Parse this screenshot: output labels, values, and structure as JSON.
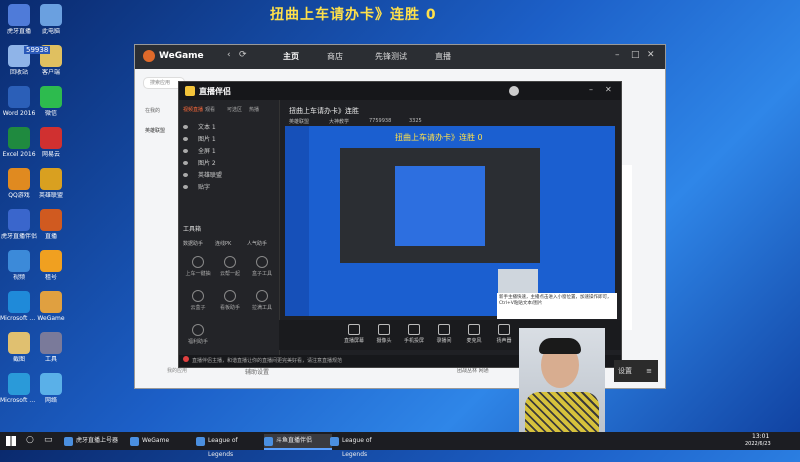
{
  "stream": {
    "title": "扭曲上车请办卡》连胜 0"
  },
  "desktop": {
    "icons": [
      {
        "label": "虎牙直播",
        "color": "#4f7bd9"
      },
      {
        "label": "此电脑",
        "color": "#6aa0e0"
      },
      {
        "label": "回收站",
        "color": "#8fb4e8"
      },
      {
        "label": "客户端",
        "color": "#e0c060"
      },
      {
        "label": "Word 2016",
        "color": "#2b5fb8"
      },
      {
        "label": "微信",
        "color": "#2dbb4e"
      },
      {
        "label": "Excel 2016",
        "color": "#1f8a3f"
      },
      {
        "label": "网易云",
        "color": "#d03030"
      },
      {
        "label": "QQ游戏",
        "color": "#e08a20"
      },
      {
        "label": "英雄联盟",
        "color": "#d9a020"
      },
      {
        "label": "虎牙直播伴侣",
        "color": "#3a66cc"
      },
      {
        "label": "直播",
        "color": "#d05a20"
      },
      {
        "label": "视频",
        "color": "#3c8ad9"
      },
      {
        "label": "租号",
        "color": "#f0a020"
      },
      {
        "label": "Microsoft Edge",
        "color": "#1f8ad9"
      },
      {
        "label": "WeGame",
        "color": "#e0a040"
      },
      {
        "label": "截图",
        "color": "#e0c070"
      },
      {
        "label": "工具",
        "color": "#7a7a9a"
      },
      {
        "label": "Microsoft Edge",
        "color": "#2a9ad9"
      },
      {
        "label": "网络",
        "color": "#5ab0e8"
      }
    ],
    "badge": "59938"
  },
  "wegame": {
    "brand": "WeGame",
    "tabs": [
      "主页",
      "商店",
      "先锋测试",
      "直播"
    ],
    "search_placeholder": "搜索应用",
    "side_items": [
      "在我的",
      "英雄联盟"
    ],
    "bottom_left": "我的应用",
    "bottom_mid": "辅助设置",
    "bottom_right": "团战丛林 网通"
  },
  "assistant": {
    "brand": "直播伴侣",
    "menu": [
      "视频直播",
      "观看",
      "可选区",
      "热播"
    ],
    "room": "扭曲上车请办卡》连胜",
    "room_tags": [
      "英雄联盟",
      "大神教学",
      "7759938",
      "3325"
    ],
    "layers": [
      "文本 1",
      "图片 1",
      "全屏 1",
      "图片 2",
      "英雄联盟",
      "贴字"
    ],
    "toolbox": "工具箱",
    "tool_tabs": [
      "数据助手",
      "连线PK",
      "人气助手"
    ],
    "tools": [
      "上车一键抽",
      "云帮一起",
      "盒子工具",
      "云盒子",
      "看板助手",
      "拉满工具",
      "福利助手"
    ],
    "bottom_tools": [
      "直播屏幕",
      "摄像头",
      "手机投屏",
      "录播间",
      "麦克风",
      "扬声器"
    ],
    "notice": "直播伴侣主播，和谐直播让你的直播间更完美好看，请注意直播规范",
    "preview_title": "扭曲上车请办卡》连胜 0"
  },
  "overlay": {
    "caption": "新手主播快速，主播点击进入小窗位置，加速操作即可，Ctrl+V粘贴文本/图片"
  },
  "side_button": "设置",
  "taskbar": {
    "apps": [
      "虎牙直播上号器",
      "WeGame",
      "League of Legends",
      "斗鱼直播伴侣",
      "League of Legends"
    ],
    "time": "13:01",
    "date": "2022/6/23"
  }
}
